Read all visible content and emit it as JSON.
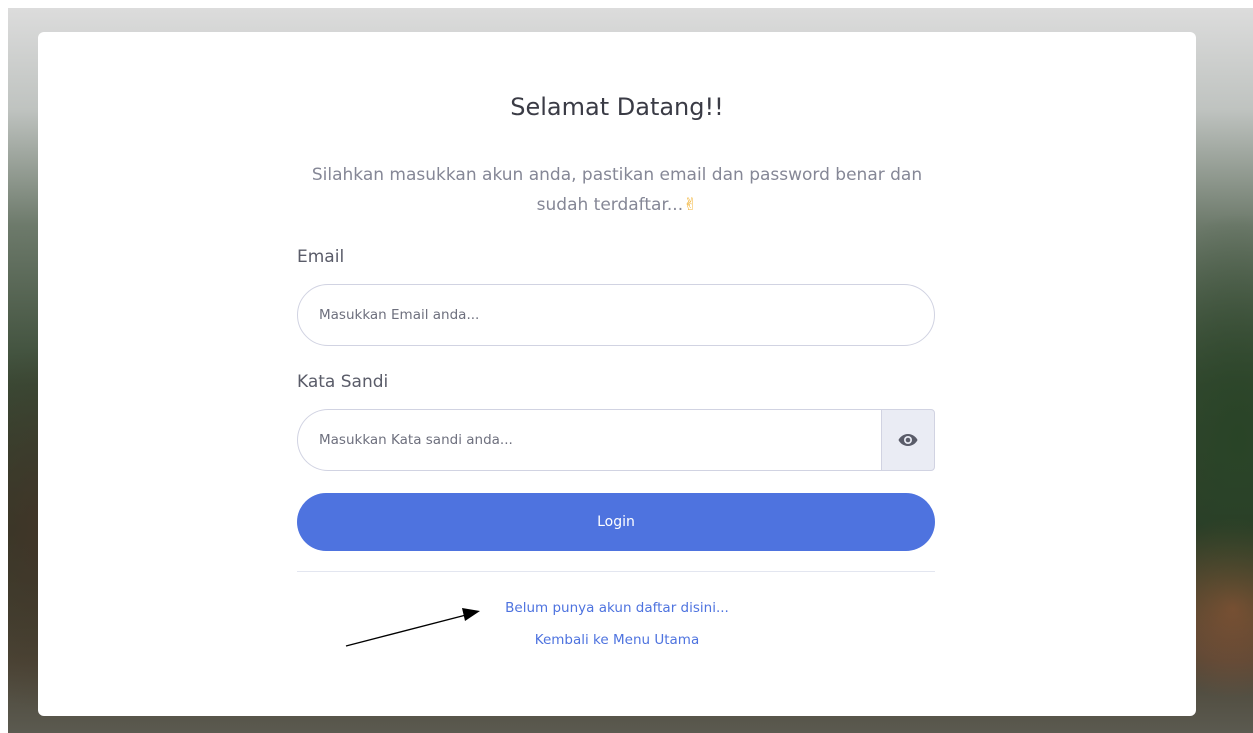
{
  "login": {
    "title": "Selamat Datang!!",
    "subtitle": "Silahkan masukkan akun anda, pastikan email dan password benar dan sudah terdaftar...",
    "subtitle_emoji": "✌",
    "email_label": "Email",
    "email_placeholder": "Masukkan Email anda...",
    "email_value": "",
    "password_label": "Kata Sandi",
    "password_placeholder": "Masukkan Kata sandi anda...",
    "password_value": "",
    "login_label": "Login",
    "register_link": "Belum punya akun daftar disini...",
    "home_link": "Kembali ke Menu Utama"
  },
  "icons": {
    "password_toggle": "eye-icon",
    "annotation": "arrow-annotation"
  },
  "colors": {
    "primary": "#4e73df",
    "heading": "#3a3b45",
    "muted": "#858796",
    "border": "#d1d3e2",
    "addon_bg": "#eaecf4"
  }
}
